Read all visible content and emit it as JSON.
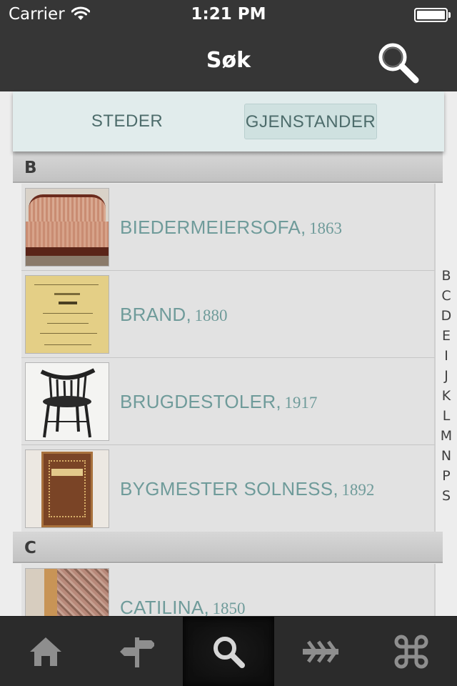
{
  "status_bar": {
    "carrier": "Carrier",
    "time": "1:21 PM",
    "battery_level": 1.0
  },
  "nav": {
    "title": "Søk",
    "search_icon": "magnifier-icon"
  },
  "segments": [
    {
      "label": "STEDER",
      "selected": false
    },
    {
      "label": "GJENSTANDER",
      "selected": true
    }
  ],
  "sections": [
    {
      "letter": "B",
      "items": [
        {
          "name": "BIEDERMEIERSOFA,",
          "year": "1863"
        },
        {
          "name": "BRAND,",
          "year": "1880"
        },
        {
          "name": "BRUGDESTOLER,",
          "year": "1917"
        },
        {
          "name": "BYGMESTER SOLNESS,",
          "year": "1892"
        }
      ]
    },
    {
      "letter": "C",
      "items": [
        {
          "name": "CATILINA,",
          "year": "1850"
        }
      ]
    }
  ],
  "index_letters": [
    "B",
    "C",
    "D",
    "E",
    "I",
    "J",
    "K",
    "L",
    "M",
    "N",
    "P",
    "S"
  ],
  "tabs": [
    {
      "icon": "home-icon",
      "selected": false
    },
    {
      "icon": "signpost-icon",
      "selected": false
    },
    {
      "icon": "search-icon",
      "selected": true
    },
    {
      "icon": "arrows-icon",
      "selected": false
    },
    {
      "icon": "command-icon",
      "selected": false
    }
  ],
  "colors": {
    "bar": "#363636",
    "accent_text": "#6f9b9a",
    "segment_text": "#4d6c6b",
    "tabbar": "#2b2b2b",
    "tab_icon": "#8e8e8e",
    "tab_icon_active": "#d7d7d7"
  }
}
